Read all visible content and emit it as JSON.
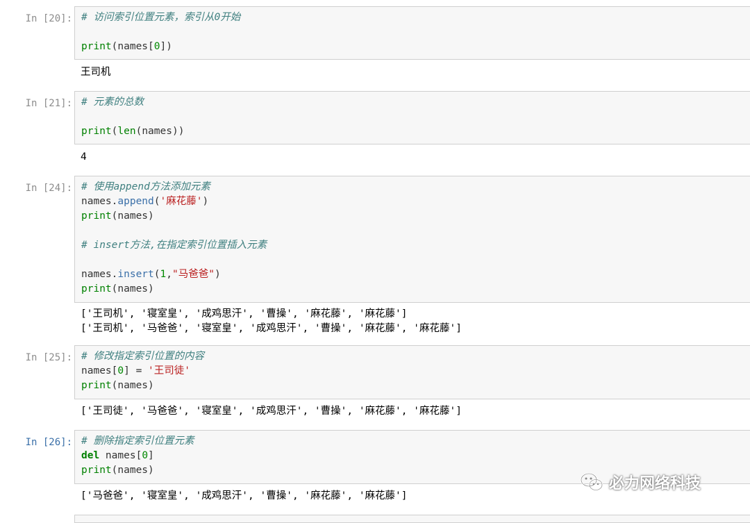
{
  "cells": [
    {
      "prompt": "In [20]:",
      "lines": {
        "l1": "# 访问索引位置元素，索引从0开始",
        "l2": "",
        "l3_fn": "print",
        "l3_rest": "(names[",
        "l3_num": "0",
        "l3_end": "])"
      },
      "output": [
        "王司机"
      ]
    },
    {
      "prompt": "In [21]:",
      "lines": {
        "l1": "# 元素的总数",
        "l2": "",
        "l3_fn": "print",
        "l3_p": "(",
        "l3_fn2": "len",
        "l3_end": "(names))"
      },
      "output": [
        "4"
      ]
    },
    {
      "prompt": "In [24]:",
      "lines": {
        "l1": "# 使用append方法添加元素",
        "l2_a": "names.",
        "l2_fn": "append",
        "l2_b": "(",
        "l2_str": "'麻花藤'",
        "l2_c": ")",
        "l3_fn": "print",
        "l3_rest": "(names)",
        "l5": "# insert方法,在指定索引位置插入元素",
        "l7_a": "names.",
        "l7_fn": "insert",
        "l7_b": "(",
        "l7_num": "1",
        "l7_c": ",",
        "l7_str": "\"马爸爸\"",
        "l7_d": ")",
        "l8_fn": "print",
        "l8_rest": "(names)"
      },
      "output": [
        "['王司机', '寝室皇', '成鸡思汗', '曹操', '麻花藤', '麻花藤']",
        "['王司机', '马爸爸', '寝室皇', '成鸡思汗', '曹操', '麻花藤', '麻花藤']"
      ]
    },
    {
      "prompt": "In [25]:",
      "lines": {
        "l1": "# 修改指定索引位置的内容",
        "l2_a": "names[",
        "l2_num": "0",
        "l2_b": "] = ",
        "l2_str": "'王司徒'",
        "l3_fn": "print",
        "l3_rest": "(names)"
      },
      "output": [
        "['王司徒', '马爸爸', '寝室皇', '成鸡思汗', '曹操', '麻花藤', '麻花藤']"
      ]
    },
    {
      "prompt": "In [26]:",
      "lines": {
        "l1": "# 删除指定索引位置元素",
        "l2_kw": "del",
        "l2_a": " names[",
        "l2_num": "0",
        "l2_b": "]",
        "l3_fn": "print",
        "l3_rest": "(names)"
      },
      "output": [
        "['马爸爸', '寝室皇', '成鸡思汗', '曹操', '麻花藤', '麻花藤']"
      ]
    }
  ],
  "watermark": {
    "text": "必力网络科技",
    "icon": "wechat-icon"
  }
}
